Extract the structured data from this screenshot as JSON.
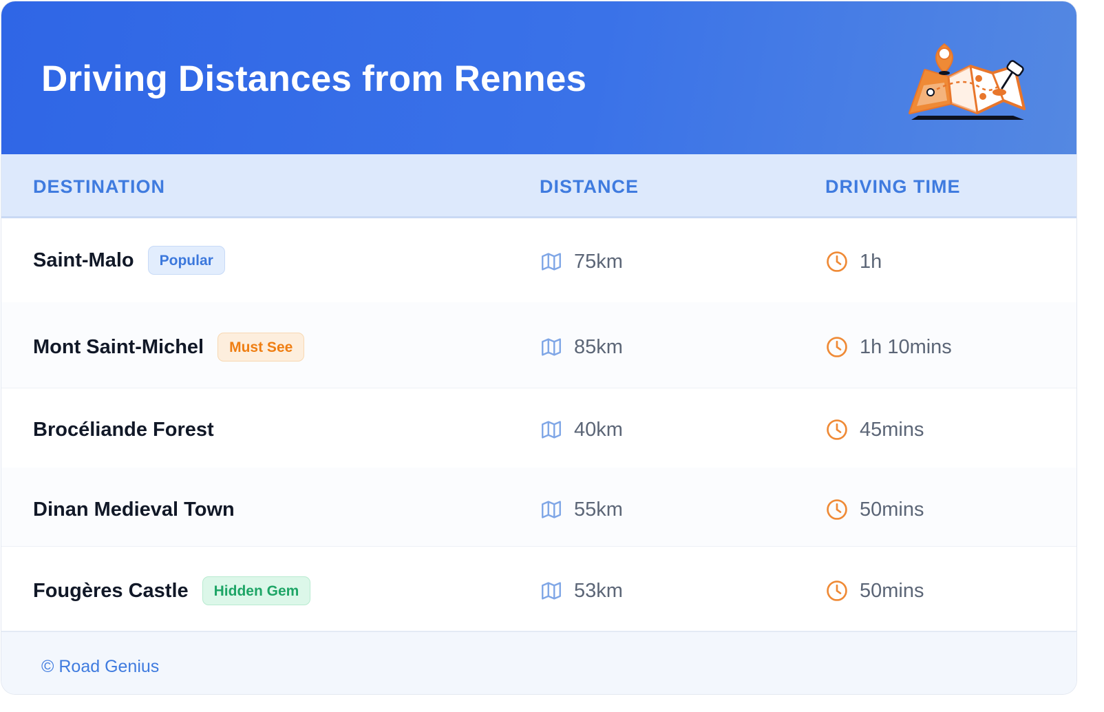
{
  "header": {
    "title": "Driving Distances from Rennes"
  },
  "table": {
    "columns": {
      "destination": "DESTINATION",
      "distance": "DISTANCE",
      "driving_time": "DRIVING TIME"
    },
    "rows": [
      {
        "destination": "Saint-Malo",
        "badge": "Popular",
        "distance": "75km",
        "time": "1h"
      },
      {
        "destination": "Mont Saint-Michel",
        "badge": "Must See",
        "distance": "85km",
        "time": "1h 10mins"
      },
      {
        "destination": "Brocéliande Forest",
        "distance": "40km",
        "time": "45mins"
      },
      {
        "destination": "Dinan Medieval Town",
        "distance": "55km",
        "time": "50mins"
      },
      {
        "destination": "Fougères Castle",
        "badge": "Hidden Gem",
        "distance": "53km",
        "time": "50mins"
      }
    ]
  },
  "icons": {
    "distance": "map-icon",
    "time": "clock-icon",
    "header": "map-pin-illustration"
  },
  "colors": {
    "header_blue": "#2f66e6",
    "accent_blue": "#3f7bdf",
    "accent_orange": "#ef8a36",
    "badge_popular": "#3c78dc",
    "badge_must_see": "#ef7e12",
    "badge_hidden_gem": "#1ea566"
  },
  "footer": {
    "text": "© Road Genius"
  }
}
